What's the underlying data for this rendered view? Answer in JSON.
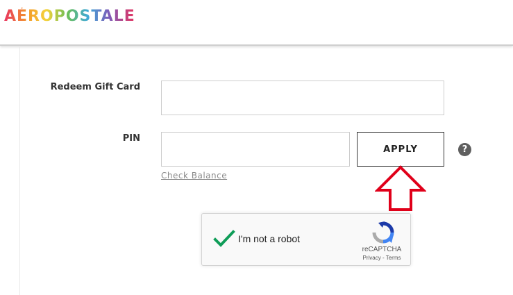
{
  "header": {
    "logo_text": "AÉROPOSTALE"
  },
  "gift_card_form": {
    "gift_card_label": "Redeem Gift Card",
    "gift_card_value": "",
    "pin_label": "PIN",
    "pin_value": "",
    "apply_label": "APPLY",
    "help_label": "?",
    "check_balance_label": "Check Balance"
  },
  "annotation": {
    "arrow_color": "#e0001a",
    "arrow_icon": "up-arrow-icon"
  },
  "recaptcha": {
    "checkbox_label": "I'm not a robot",
    "checked": true,
    "check_color": "#0f9d58",
    "brand": "reCAPTCHA",
    "privacy_label": "Privacy",
    "separator": " - ",
    "terms_label": "Terms"
  }
}
